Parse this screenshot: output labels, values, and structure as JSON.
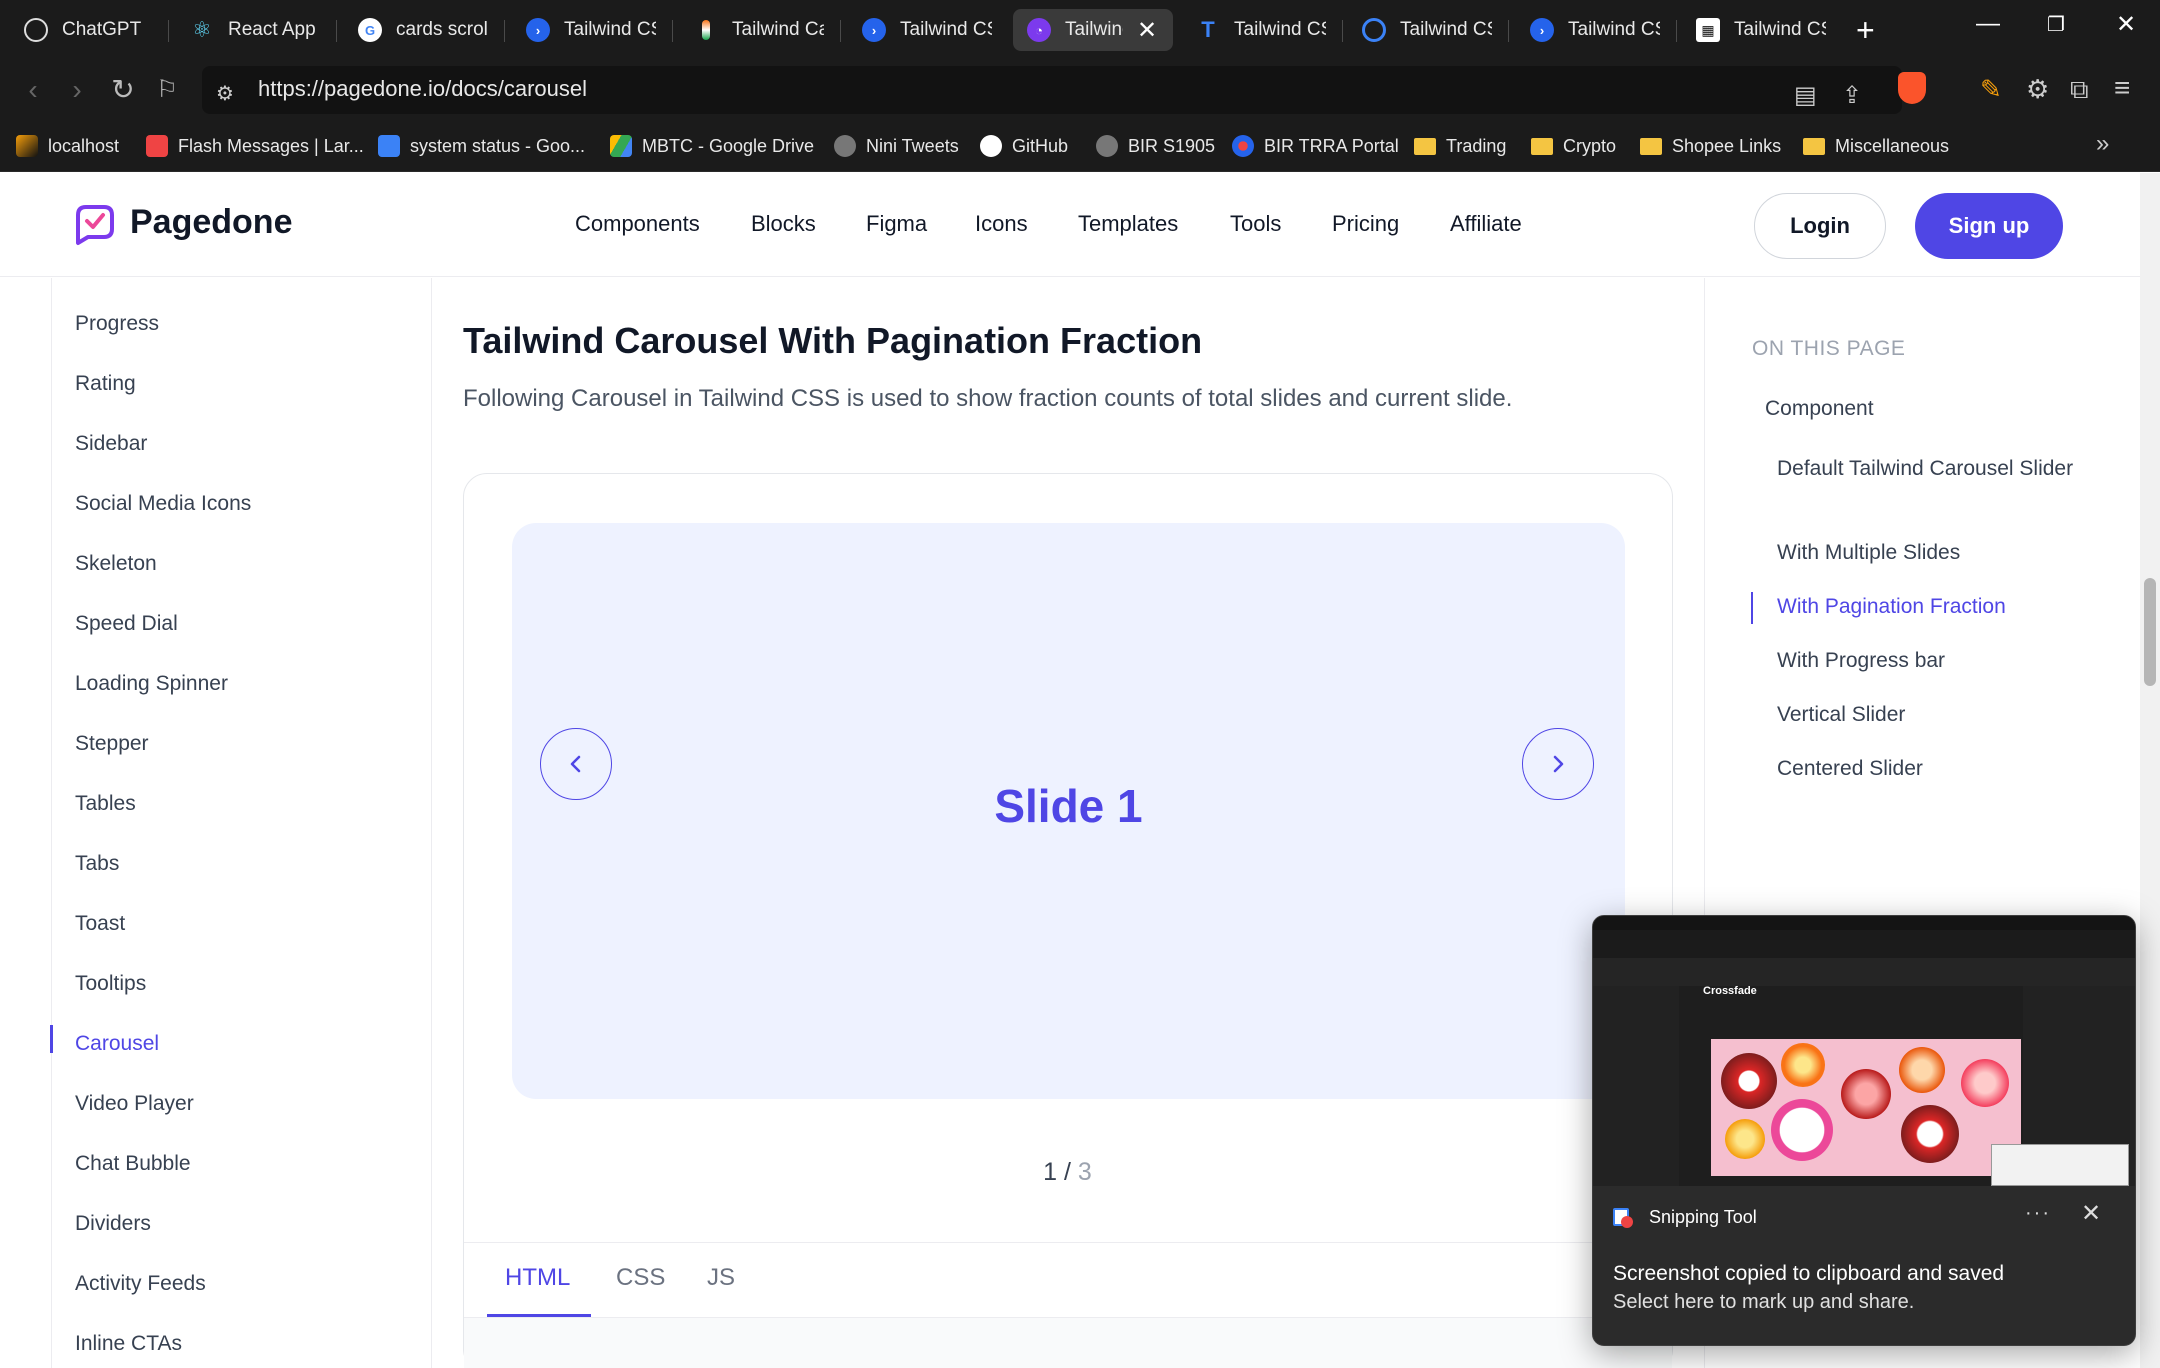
{
  "browser": {
    "tabs": [
      {
        "label": "ChatGPT",
        "icon": "chatgpt-icon"
      },
      {
        "label": "React App",
        "icon": "react-icon"
      },
      {
        "label": "cards scroll",
        "icon": "google-icon"
      },
      {
        "label": "Tailwind CSS",
        "icon": "tailwind-icon"
      },
      {
        "label": "Tailwind Car",
        "icon": "flag-icon"
      },
      {
        "label": "Tailwind CSS",
        "icon": "tailwind-icon"
      },
      {
        "label": "Tailwind",
        "icon": "pagedone-icon",
        "active": true
      },
      {
        "label": "Tailwind CSS",
        "icon": "te-icon"
      },
      {
        "label": "Tailwind CSS",
        "icon": "ripple-icon"
      },
      {
        "label": "Tailwind CSS",
        "icon": "tailwind-icon"
      },
      {
        "label": "Tailwind CSS",
        "icon": "grid-icon"
      }
    ],
    "url": "https://pagedone.io/docs/carousel",
    "bookmarks": [
      {
        "label": "localhost",
        "icon": "localhost-icon"
      },
      {
        "label": "Flash Messages | Lar...",
        "icon": "youtube-icon"
      },
      {
        "label": "system status - Goo...",
        "icon": "docs-icon"
      },
      {
        "label": "MBTC - Google Drive",
        "icon": "drive-icon"
      },
      {
        "label": "Nini Tweets",
        "icon": "globe-icon"
      },
      {
        "label": "GitHub",
        "icon": "github-icon"
      },
      {
        "label": "BIR S1905",
        "icon": "globe-icon"
      },
      {
        "label": "BIR TRRA Portal",
        "icon": "bir-icon"
      },
      {
        "label": "Trading",
        "icon": "folder-icon"
      },
      {
        "label": "Crypto",
        "icon": "folder-icon"
      },
      {
        "label": "Shopee Links",
        "icon": "folder-icon"
      },
      {
        "label": "Miscellaneous",
        "icon": "folder-icon"
      }
    ]
  },
  "site": {
    "brand": "Pagedone",
    "nav": [
      "Components",
      "Blocks",
      "Figma",
      "Icons",
      "Templates",
      "Tools",
      "Pricing",
      "Affiliate"
    ],
    "login": "Login",
    "signup": "Sign up",
    "accent_color": "#4f46e5"
  },
  "sidebar": {
    "items": [
      "Progress",
      "Rating",
      "Sidebar",
      "Social Media Icons",
      "Skeleton",
      "Speed Dial",
      "Loading Spinner",
      "Stepper",
      "Tables",
      "Tabs",
      "Toast",
      "Tooltips",
      "Carousel",
      "Video Player",
      "Chat Bubble",
      "Dividers",
      "Activity Feeds",
      "Inline CTAs"
    ],
    "active": "Carousel"
  },
  "content": {
    "title": "Tailwind Carousel With Pagination Fraction",
    "description": "Following Carousel in Tailwind CSS is used to show fraction counts of total slides and current slide.",
    "slide_label": "Slide 1",
    "fraction_current": "1",
    "fraction_sep": " / ",
    "fraction_total": "3",
    "code_tabs": [
      "HTML",
      "CSS",
      "JS"
    ],
    "active_code_tab": "HTML"
  },
  "toc": {
    "heading": "ON THIS PAGE",
    "items": [
      "Component",
      "Default Tailwind Carousel Slider",
      "With Multiple Slides",
      "With Pagination Fraction",
      "With Progress bar",
      "Vertical Slider",
      "Centered Slider"
    ],
    "active": "With Pagination Fraction"
  },
  "toast": {
    "app": "Snipping Tool",
    "message": "Screenshot copied to clipboard and saved",
    "sub": "Select here to mark up and share.",
    "thumbnail_title": "Crossfade"
  }
}
